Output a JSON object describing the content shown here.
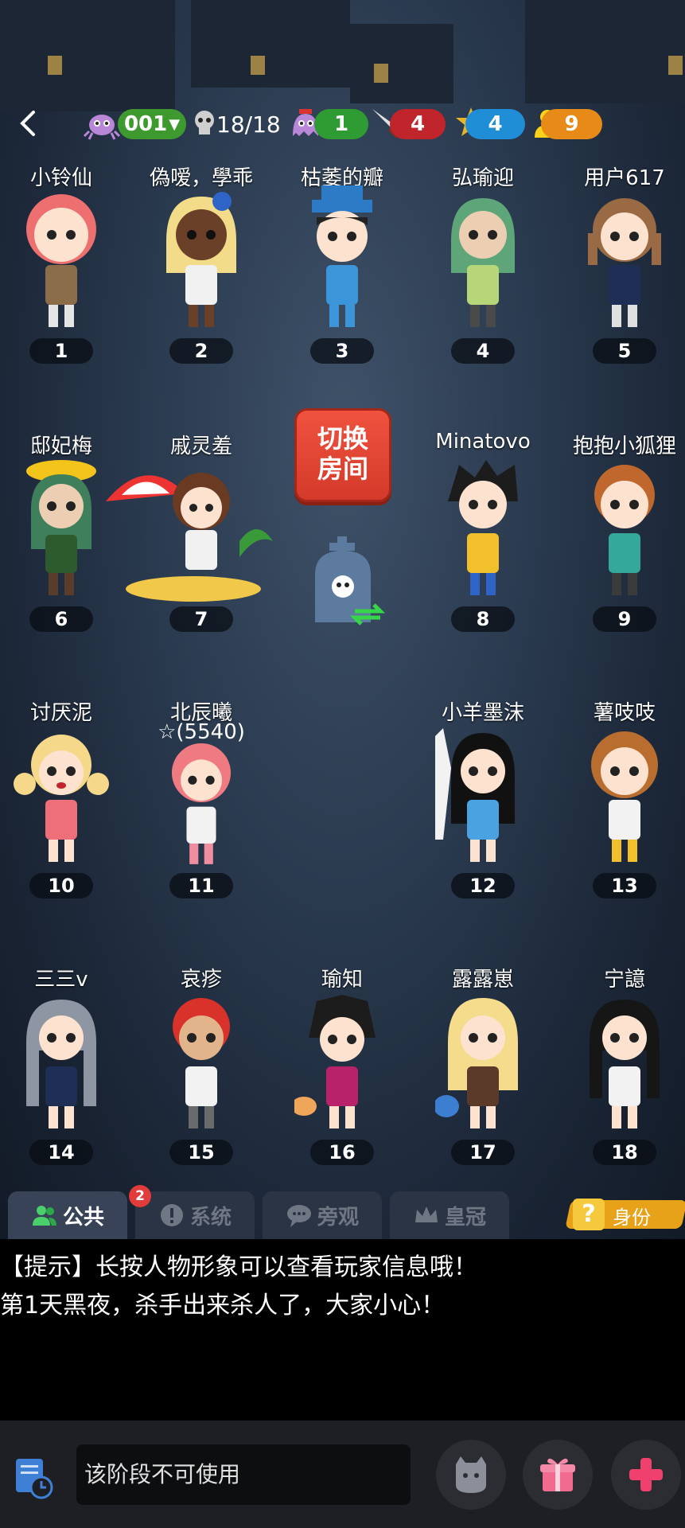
{
  "topbar": {
    "room_number": "001",
    "alive_count": "18/18",
    "ghost_count": "1",
    "killer_count": "4",
    "police_count": "4",
    "civilian_count": "9",
    "colors": {
      "green": "#3e9a2f",
      "red": "#c0252b",
      "blue": "#1f8ed6",
      "orange": "#e88a18"
    }
  },
  "switch_room": {
    "line1": "切换",
    "line2": "房间"
  },
  "players": [
    {
      "name": "小铃仙",
      "seat": "1",
      "extra": ""
    },
    {
      "name": "偽嗳，學乖",
      "seat": "2",
      "extra": ""
    },
    {
      "name": "枯萎的瓣",
      "seat": "3",
      "extra": ""
    },
    {
      "name": "弘瑜迎",
      "seat": "4",
      "extra": ""
    },
    {
      "name": "用户617",
      "seat": "5",
      "extra": ""
    },
    {
      "name": "邸妃梅",
      "seat": "6",
      "extra": ""
    },
    {
      "name": "戚灵羞",
      "seat": "7",
      "extra": ""
    },
    {
      "name": "Minatovo",
      "seat": "8",
      "extra": ""
    },
    {
      "name": "抱抱小狐狸",
      "seat": "9",
      "extra": ""
    },
    {
      "name": "讨厌泥",
      "seat": "10",
      "extra": ""
    },
    {
      "name": "北辰曦",
      "seat": "11",
      "extra": "☆(5540)"
    },
    {
      "name": "小羊墨沫",
      "seat": "12",
      "extra": ""
    },
    {
      "name": "薯吱吱",
      "seat": "13",
      "extra": ""
    },
    {
      "name": "三三v",
      "seat": "14",
      "extra": ""
    },
    {
      "name": "哀疹",
      "seat": "15",
      "extra": ""
    },
    {
      "name": "瑜知",
      "seat": "16",
      "extra": ""
    },
    {
      "name": "露露崽",
      "seat": "17",
      "extra": ""
    },
    {
      "name": "宁譩",
      "seat": "18",
      "extra": ""
    }
  ],
  "tabs": {
    "public": "公共",
    "system": "系统",
    "system_badge": "2",
    "watch": "旁观",
    "crown": "皇冠",
    "identity": "身份",
    "identity_q": "?"
  },
  "chat": {
    "lines": [
      "【提示】长按人物形象可以查看玩家信息哦！",
      "第1天黑夜，杀手出来杀人了，大家小心！"
    ]
  },
  "bottom": {
    "input_placeholder": "该阶段不可使用"
  }
}
